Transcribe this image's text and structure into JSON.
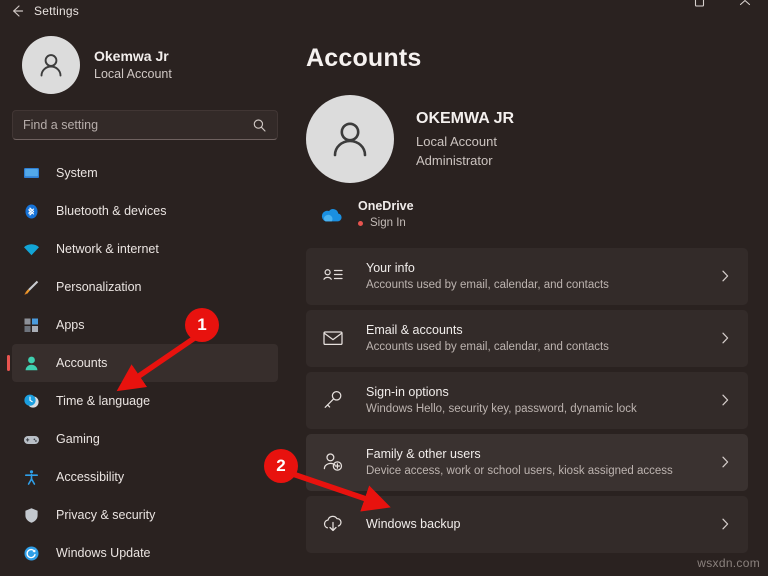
{
  "window": {
    "title": "Settings",
    "back_icon": "back-arrow-icon",
    "restore_icon": "restore-icon",
    "chevron_icon": "chevron-up-icon"
  },
  "sidebar": {
    "profile": {
      "name": "Okemwa Jr",
      "account_type": "Local Account",
      "avatar_icon": "person-avatar-icon"
    },
    "search": {
      "placeholder": "Find a setting",
      "value": "",
      "icon": "search-icon"
    },
    "items": [
      {
        "label": "System",
        "icon": "monitor-icon",
        "selected": false
      },
      {
        "label": "Bluetooth & devices",
        "icon": "bluetooth-icon",
        "selected": false
      },
      {
        "label": "Network & internet",
        "icon": "wifi-icon",
        "selected": false
      },
      {
        "label": "Personalization",
        "icon": "paintbrush-icon",
        "selected": false
      },
      {
        "label": "Apps",
        "icon": "apps-grid-icon",
        "selected": false
      },
      {
        "label": "Accounts",
        "icon": "person-icon",
        "selected": true
      },
      {
        "label": "Time & language",
        "icon": "clock-icon",
        "selected": false
      },
      {
        "label": "Gaming",
        "icon": "gamepad-icon",
        "selected": false
      },
      {
        "label": "Accessibility",
        "icon": "accessibility-icon",
        "selected": false
      },
      {
        "label": "Privacy & security",
        "icon": "shield-icon",
        "selected": false
      },
      {
        "label": "Windows Update",
        "icon": "update-icon",
        "selected": false
      }
    ]
  },
  "main": {
    "page_title": "Accounts",
    "hero": {
      "name": "OKEMWA JR",
      "account_type": "Local Account",
      "role": "Administrator",
      "avatar_icon": "person-avatar-icon"
    },
    "onedrive": {
      "title": "OneDrive",
      "status": "Sign In",
      "icon": "onedrive-cloud-icon",
      "dot_color": "#e8544f"
    },
    "cards": [
      {
        "title": "Your info",
        "subtitle": "Accounts used by email, calendar, and contacts",
        "icon": "person-details-icon",
        "chevron": "chevron-right-icon",
        "hover": false
      },
      {
        "title": "Email & accounts",
        "subtitle": "Accounts used by email, calendar, and contacts",
        "icon": "envelope-icon",
        "chevron": "chevron-right-icon",
        "hover": false
      },
      {
        "title": "Sign-in options",
        "subtitle": "Windows Hello, security key, password, dynamic lock",
        "icon": "key-icon",
        "chevron": "chevron-right-icon",
        "hover": false
      },
      {
        "title": "Family & other users",
        "subtitle": "Device access, work or school users, kiosk assigned access",
        "icon": "person-add-icon",
        "chevron": "chevron-right-icon",
        "hover": true
      },
      {
        "title": "Windows backup",
        "subtitle": "",
        "icon": "backup-icon",
        "chevron": "chevron-right-icon",
        "hover": false
      }
    ]
  },
  "annotations": {
    "color": "#e8120e",
    "markers": [
      {
        "number": "1",
        "target": "sidebar-item-accounts"
      },
      {
        "number": "2",
        "target": "card-family-other-users"
      }
    ]
  },
  "watermark": "wsxdn.com"
}
